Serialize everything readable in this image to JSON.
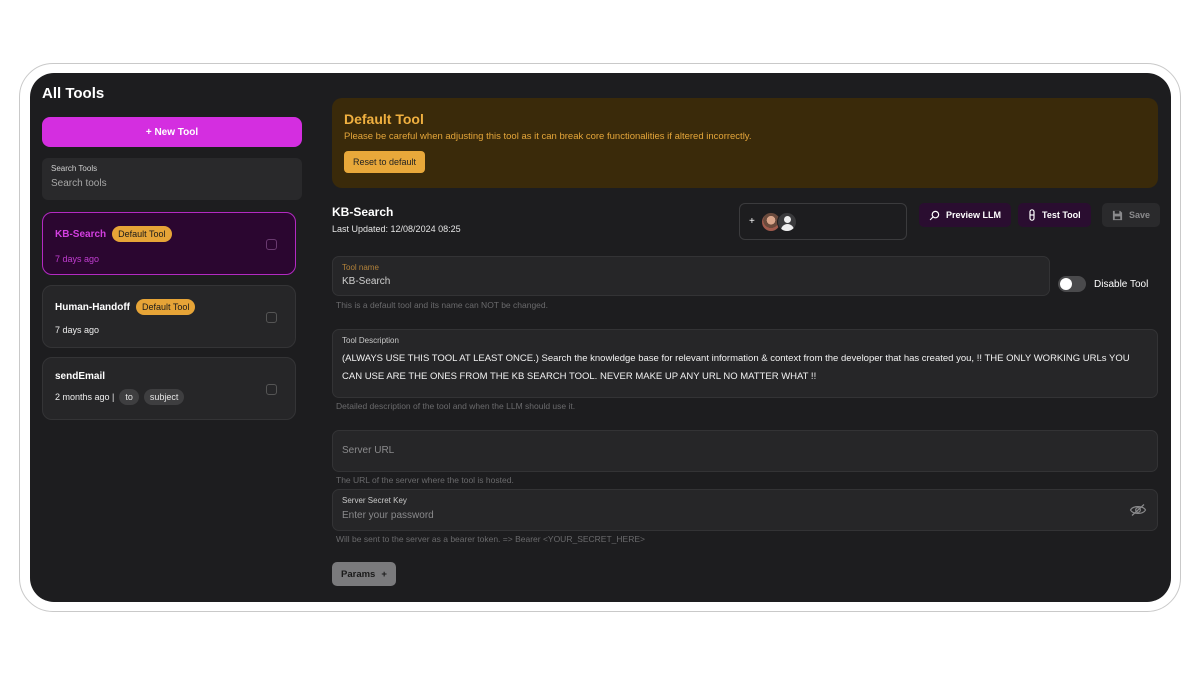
{
  "sidebar": {
    "title": "All Tools",
    "new_tool_label": "+ New Tool",
    "search": {
      "label": "Search Tools",
      "placeholder": "Search tools"
    },
    "tools": [
      {
        "name": "KB-Search",
        "badge": "Default Tool",
        "meta": "7 days ago",
        "active": true
      },
      {
        "name": "Human-Handoff",
        "badge": "Default Tool",
        "meta": "7 days ago",
        "active": false
      },
      {
        "name": "sendEmail",
        "badge": "",
        "meta": "2 months ago |",
        "params": [
          "to",
          "subject"
        ],
        "active": false
      }
    ]
  },
  "warning": {
    "title": "Default Tool",
    "text": "Please be careful when adjusting this tool as it can break core functionalities if altered incorrectly.",
    "reset_label": "Reset to default"
  },
  "tool": {
    "name": "KB-Search",
    "last_updated": "Last Updated: 12/08/2024 08:25"
  },
  "users": {
    "plus": "+"
  },
  "actions": {
    "preview_label": "Preview LLM",
    "test_label": "Test Tool",
    "save_label": "Save"
  },
  "form": {
    "name_label": "Tool name",
    "name_value": "KB-Search",
    "name_helper": "This is a default tool and its name can NOT be changed.",
    "disable_label": "Disable Tool",
    "disabled": false,
    "description_label": "Tool Description",
    "description_value": "(ALWAYS USE THIS TOOL AT LEAST ONCE.) Search the knowledge base for relevant information & context from the developer that has created you, !! THE ONLY WORKING URLs YOU CAN USE ARE THE ONES FROM THE KB SEARCH TOOL. NEVER MAKE UP ANY URL NO MATTER WHAT !!",
    "description_helper": "Detailed description of the tool and when the LLM should use it.",
    "server_url_placeholder": "Server URL",
    "server_url_helper": "The URL of the server where the tool is hosted.",
    "secret_label": "Server Secret Key",
    "secret_placeholder": "Enter your password",
    "secret_helper": "Will be sent to the server as a bearer token. => Bearer <YOUR_SECRET_HERE>",
    "params_label": "Params",
    "params_icon": "+"
  },
  "colors": {
    "accent": "#d42ee0",
    "warning_bg": "#3a2a0a",
    "warning_text": "#f0b040",
    "badge": "#e6a437"
  }
}
